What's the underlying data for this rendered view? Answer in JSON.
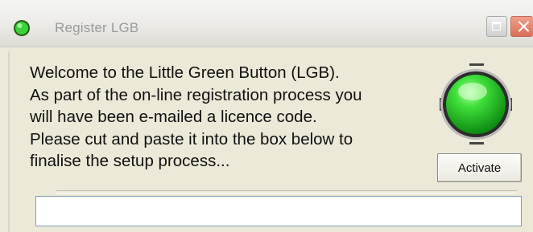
{
  "window": {
    "title": "Register LGB",
    "icon": "green-led-icon",
    "controls": [
      "maximize-icon",
      "close-icon"
    ],
    "close_color": "#d97058"
  },
  "message": {
    "lines": [
      "Welcome to the Little Green Button (LGB).",
      "As part of the on-line registration process you",
      "will have been e-mailed a licence code.",
      "Please cut and paste it into the box below to",
      "finalise the setup process..."
    ]
  },
  "button_graphic": {
    "icon": "green-button-icon",
    "color": "#1fbf1f"
  },
  "activate": {
    "label": "Activate"
  },
  "licence_code": {
    "value": ""
  }
}
